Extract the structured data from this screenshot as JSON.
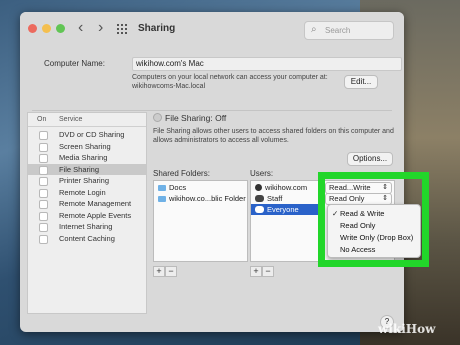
{
  "window": {
    "title": "Sharing",
    "search_placeholder": "Search",
    "nav_back": "‹",
    "nav_forward": "›"
  },
  "computer_name": {
    "label": "Computer Name:",
    "value": "wikihow.com's Mac",
    "info_line1": "Computers on your local network can access your computer at:",
    "info_line2": "wikihowcoms-Mac.local",
    "edit_button": "Edit..."
  },
  "services": {
    "header_on": "On",
    "header_service": "Service",
    "items": [
      {
        "label": "DVD or CD Sharing",
        "selected": false
      },
      {
        "label": "Screen Sharing",
        "selected": false
      },
      {
        "label": "Media Sharing",
        "selected": false
      },
      {
        "label": "File Sharing",
        "selected": true
      },
      {
        "label": "Printer Sharing",
        "selected": false
      },
      {
        "label": "Remote Login",
        "selected": false
      },
      {
        "label": "Remote Management",
        "selected": false
      },
      {
        "label": "Remote Apple Events",
        "selected": false
      },
      {
        "label": "Internet Sharing",
        "selected": false
      },
      {
        "label": "Content Caching",
        "selected": false
      }
    ]
  },
  "file_sharing": {
    "status": "File Sharing: Off",
    "desc_line1": "File Sharing allows other users to access shared folders on this computer and",
    "desc_line2": "allows administrators to access all volumes.",
    "options_button": "Options...",
    "shared_folders_label": "Shared Folders:",
    "folders": [
      "Docs",
      "wikihow.co...blic Folder"
    ],
    "users_label": "Users:",
    "users": [
      {
        "name": "wikihow.com",
        "permission": "Read...Write"
      },
      {
        "name": "Staff",
        "permission": "Read Only"
      },
      {
        "name": "Everyone",
        "permission": ""
      }
    ],
    "plus": "+",
    "minus": "−"
  },
  "permission_menu": {
    "checkmark": "✓",
    "items": [
      "Read & Write",
      "Read Only",
      "Write Only (Drop Box)",
      "No Access"
    ],
    "checked_index": 0
  },
  "help_button": "?",
  "watermark": "wikiHow",
  "colors": {
    "highlight": "#22d62a",
    "selection": "#2a62c9"
  }
}
